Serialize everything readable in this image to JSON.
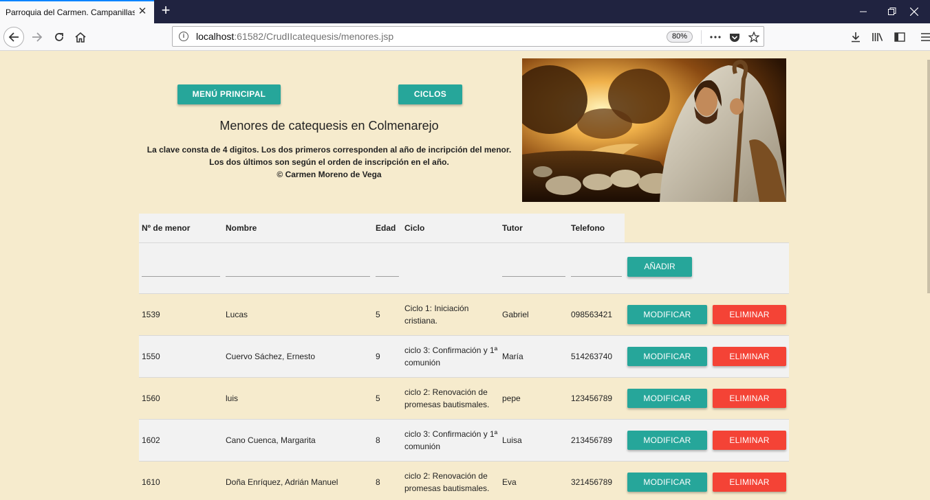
{
  "browser": {
    "tab_title": "Parroquia del Carmen. Campanillas",
    "url_host": "localhost",
    "url_rest": ":61582/CrudIIcatequesis/menores.jsp",
    "zoom": "80%"
  },
  "page": {
    "menu_button": "MENÚ PRINCIPAL",
    "ciclos_button": "CICLOS",
    "title": "Menores de catequesis en Colmenarejo",
    "desc_line1": "La clave consta de 4 digitos. Los dos primeros corresponden al año de incripción del menor.",
    "desc_line2": "Los dos últimos son según el orden de inscripción en el año.",
    "desc_line3": "© Carmen Moreno de Vega"
  },
  "table": {
    "headers": {
      "num": "Nº de menor",
      "nombre": "Nombre",
      "edad": "Edad",
      "ciclo": "Ciclo",
      "tutor": "Tutor",
      "telefono": "Telefono"
    },
    "add_button": "AÑADIR",
    "modify_label": "MODIFICAR",
    "delete_label": "ELIMINAR",
    "rows": [
      {
        "num": "1539",
        "nombre": "Lucas",
        "edad": "5",
        "ciclo": "Ciclo 1: Iniciación cristiana.",
        "tutor": "Gabriel",
        "telefono": "098563421"
      },
      {
        "num": "1550",
        "nombre": "Cuervo Sáchez, Ernesto",
        "edad": "9",
        "ciclo": "ciclo 3: Confirmación y 1ª comunión",
        "tutor": "María",
        "telefono": "514263740"
      },
      {
        "num": "1560",
        "nombre": "luis",
        "edad": "5",
        "ciclo": "ciclo 2: Renovación de promesas bautismales.",
        "tutor": "pepe",
        "telefono": "123456789"
      },
      {
        "num": "1602",
        "nombre": "Cano Cuenca, Margarita",
        "edad": "8",
        "ciclo": "ciclo 3: Confirmación y 1ª comunión",
        "tutor": "Luisa",
        "telefono": "213456789"
      },
      {
        "num": "1610",
        "nombre": "Doña Enríquez, Adrián Manuel",
        "edad": "8",
        "ciclo": "ciclo 2: Renovación de promesas bautismales.",
        "tutor": "Eva",
        "telefono": "321456789"
      }
    ]
  },
  "colors": {
    "page_bg": "#f6ebcd",
    "teal": "#26a69a",
    "red": "#f44336",
    "row_shade": "#f2f2f2"
  }
}
